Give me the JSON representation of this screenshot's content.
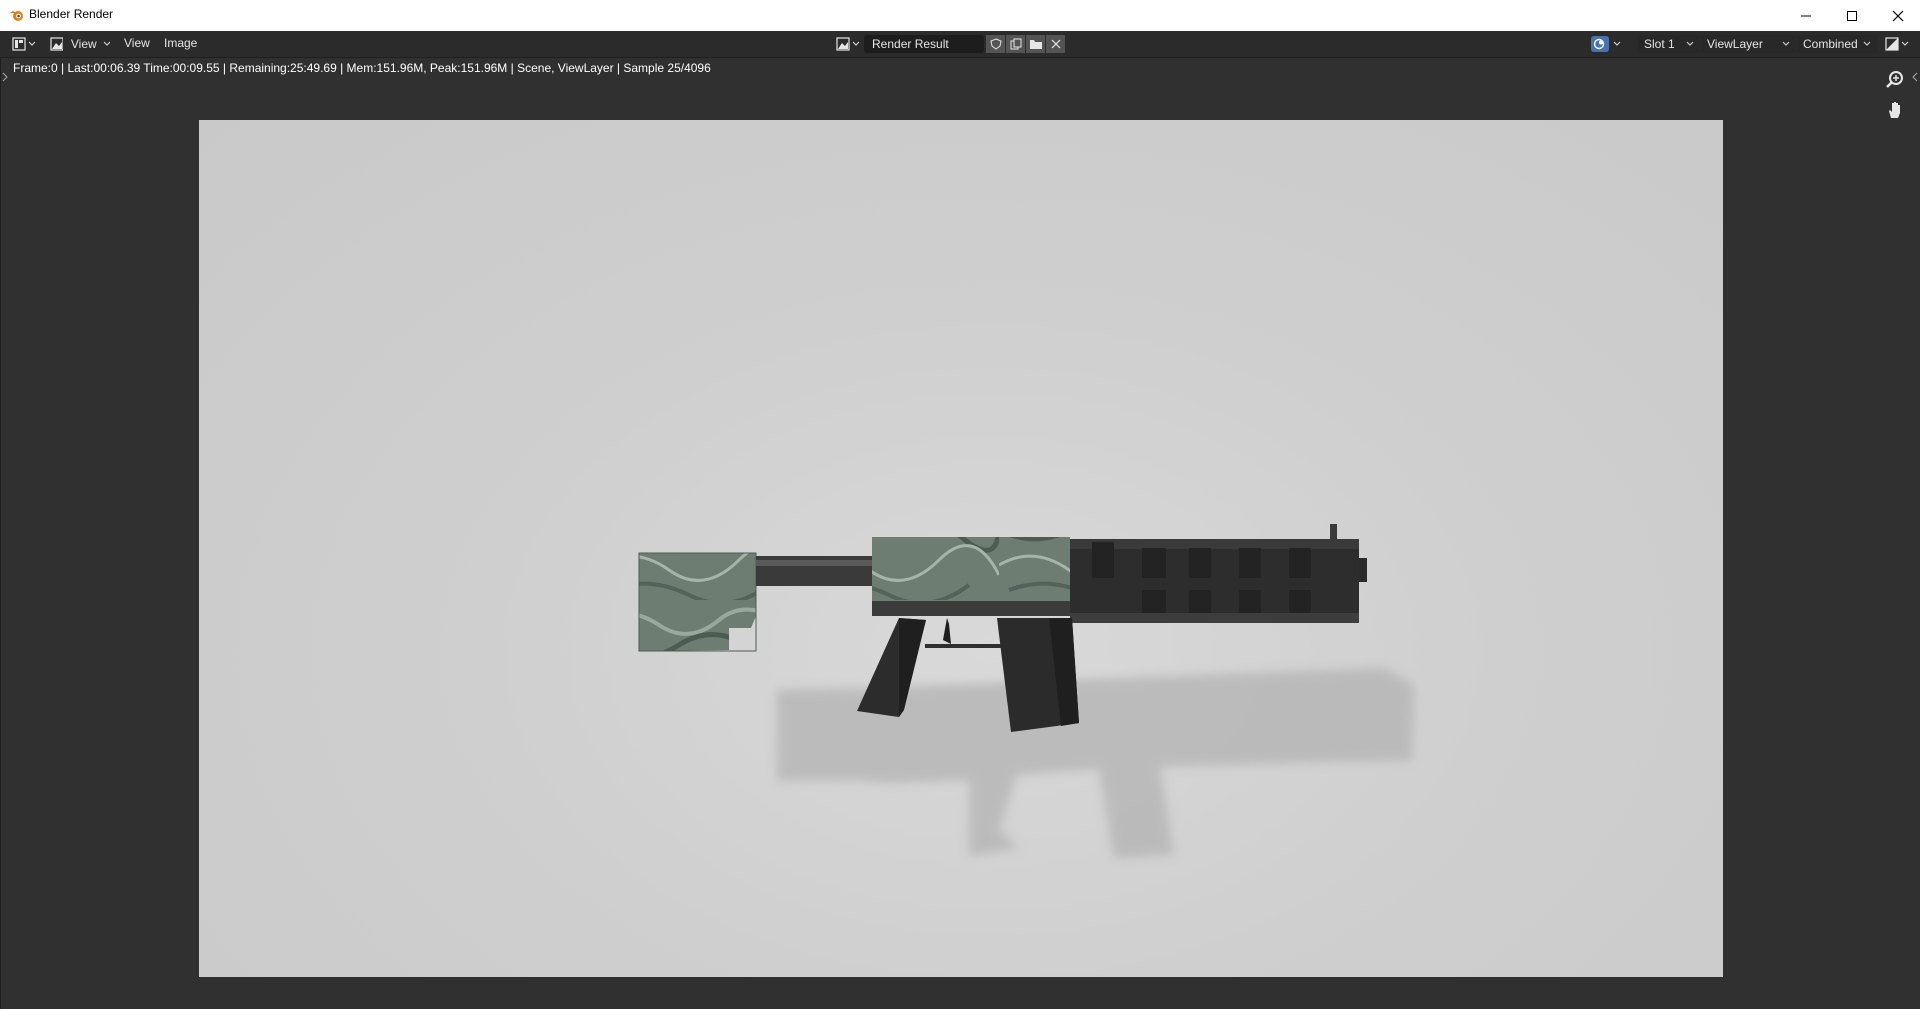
{
  "window": {
    "title": "Blender Render",
    "controls": [
      "minimize",
      "maximize",
      "close"
    ]
  },
  "header": {
    "editor_type_icon": "image-editor-icon",
    "view_menu_label": "View",
    "menus": [
      "View",
      "Image"
    ],
    "image_name": "Render Result",
    "slot": "Slot 1",
    "view_layer": "ViewLayer",
    "pass": "Combined"
  },
  "stats": {
    "text": "Frame:0 | Last:00:06.39 Time:00:09.55 | Remaining:25:49.69 | Mem:151.96M, Peak:151.96M | Scene, ViewLayer | Sample 25/4096"
  },
  "tools": [
    "zoom-icon",
    "hand-pan-icon"
  ],
  "colors": {
    "titlebar": "#ffffff",
    "header": "#2b2b2b",
    "viewport": "#303030",
    "render_bg": "#cfcfcf",
    "camo": "#6f7f73",
    "metal": "#2e2e2e"
  }
}
